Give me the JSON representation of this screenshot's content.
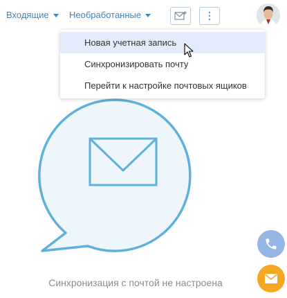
{
  "toolbar": {
    "inbox_filter": "Входящие",
    "status_filter": "Необработанные"
  },
  "dropdown": {
    "items": [
      {
        "label": "Новая учетная запись"
      },
      {
        "label": "Синхронизировать почту"
      },
      {
        "label": "Перейти к настройке почтовых ящиков"
      }
    ]
  },
  "empty_state": {
    "message": "Синхронизация с почтой не настроена"
  },
  "colors": {
    "accent": "#3b86c2",
    "bubble_stroke": "#5fb1db",
    "bubble_fill": "#eef6fb",
    "phone_fab": "#95b5e4",
    "email_fab": "#f5a623"
  },
  "icons": [
    "chevron-down-icon",
    "new-email-icon",
    "more-vertical-icon",
    "user-avatar",
    "mouse-cursor-icon",
    "envelope-icon",
    "phone-icon",
    "email-icon"
  ]
}
